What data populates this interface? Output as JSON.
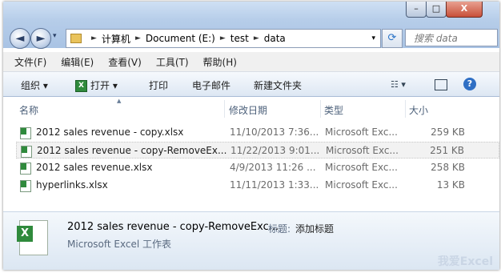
{
  "window": {
    "caption_buttons": {
      "minimize": "–",
      "maximize": "□",
      "close": "X"
    }
  },
  "nav": {
    "back": "◄",
    "forward": "►",
    "dropdown": "▾"
  },
  "address": {
    "segments": [
      "计算机",
      "Document (E:)",
      "test",
      "data"
    ],
    "separator": "►",
    "dropdown": "▾"
  },
  "refresh_icon": "⟳",
  "search": {
    "placeholder": "搜索 data"
  },
  "menubar": [
    "文件(F)",
    "编辑(E)",
    "查看(V)",
    "工具(T)",
    "帮助(H)"
  ],
  "commandbar": {
    "organize": "组织 ▾",
    "open": "打开 ▾",
    "open_icon": "X",
    "print": "打印",
    "email": "电子邮件",
    "new_folder": "新建文件夹",
    "views": "☷ ▾",
    "help": "?"
  },
  "columns": {
    "name": "名称",
    "modified": "修改日期",
    "type": "类型",
    "size": "大小",
    "sort_indicator": "▲"
  },
  "files": [
    {
      "name": "2012 sales revenue - copy.xlsx",
      "modified": "11/10/2013 7:36...",
      "type": "Microsoft Exc...",
      "size": "259 KB"
    },
    {
      "name": "2012 sales revenue - copy-RemoveEx...",
      "modified": "11/22/2013 9:01...",
      "type": "Microsoft Exc...",
      "size": "251 KB"
    },
    {
      "name": "2012 sales revenue.xlsx",
      "modified": "4/9/2013 11:26 ...",
      "type": "Microsoft Exc...",
      "size": "258 KB"
    },
    {
      "name": "hyperlinks.xlsx",
      "modified": "11/11/2013 1:33...",
      "type": "Microsoft Exc...",
      "size": "13 KB"
    }
  ],
  "selected_row": 1,
  "details": {
    "filename": "2012 sales revenue - copy-RemoveExc...",
    "filetype": "Microsoft Excel 工作表",
    "title_label": "标题:",
    "title_value": "添加标题"
  },
  "watermark": "我爱Excel"
}
